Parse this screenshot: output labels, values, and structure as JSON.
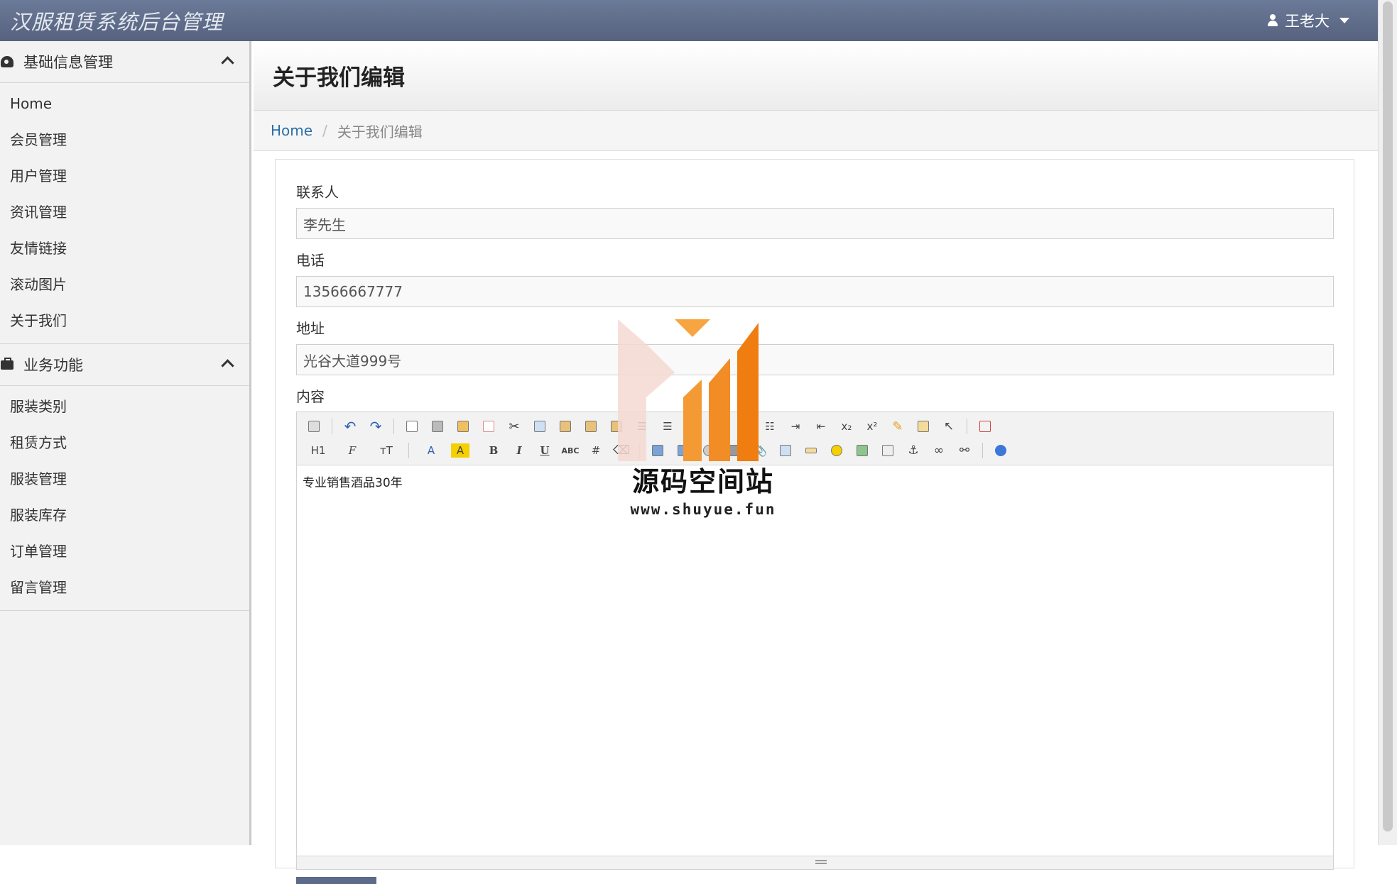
{
  "navbar": {
    "brand": "汉服租赁系统后台管理",
    "user_name": "王老大"
  },
  "sidebar": {
    "groups": [
      {
        "title": "基础信息管理",
        "icon": "dashboard-icon",
        "items": [
          "Home",
          "会员管理",
          "用户管理",
          "资讯管理",
          "友情链接",
          "滚动图片",
          "关于我们"
        ]
      },
      {
        "title": "业务功能",
        "icon": "briefcase-icon",
        "items": [
          "服装类别",
          "租赁方式",
          "服装管理",
          "服装库存",
          "订单管理",
          "留言管理"
        ]
      }
    ]
  },
  "page": {
    "title": "关于我们编辑",
    "breadcrumb": {
      "home": "Home",
      "current": "关于我们编辑"
    }
  },
  "form": {
    "contact": {
      "label": "联系人",
      "value": "李先生"
    },
    "phone": {
      "label": "电话",
      "value": "13566667777"
    },
    "address": {
      "label": "地址",
      "value": "光谷大道999号"
    },
    "content": {
      "label": "内容",
      "value": "专业销售酒品30年"
    }
  },
  "editor_toolbar": {
    "heading_label": "H1",
    "font_label": "F",
    "size_label": "тT",
    "font_color_label": "A",
    "bg_color_label": "A",
    "bold": "B",
    "italic": "I",
    "underline": "U",
    "strike": "ABC",
    "subscript": "x₂",
    "superscript": "x²"
  },
  "watermark": {
    "title": "源码空间站",
    "url": "www.shuyue.fun"
  },
  "colors": {
    "navbar": "#5d6a87",
    "link": "#2a6ea6",
    "watermark_orange": "#f08a24"
  }
}
